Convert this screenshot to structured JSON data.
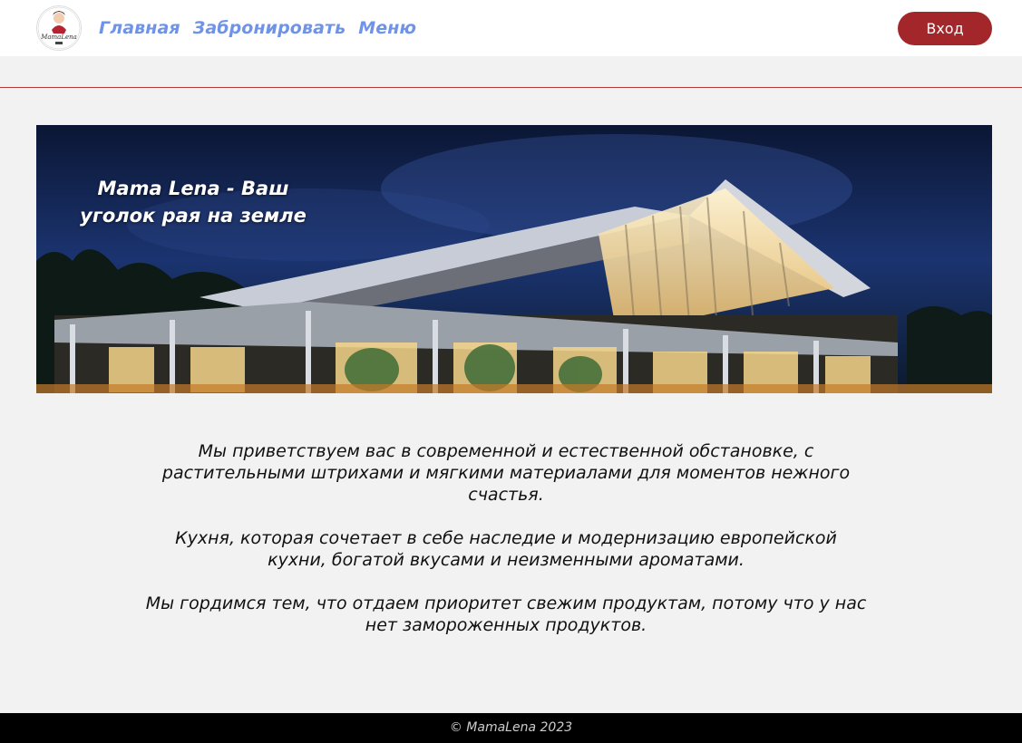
{
  "header": {
    "logo_text": "MamaLena",
    "nav": [
      {
        "label": "Главная"
      },
      {
        "label": "Забронировать"
      },
      {
        "label": "Меню"
      }
    ],
    "login_label": "Вход"
  },
  "hero": {
    "title": "Mama Lena - Ваш уголок рая на земле",
    "image_description_icon": "restaurant-building-image"
  },
  "content": {
    "paragraphs": [
      "Мы приветствуем вас в современной и естественной обстановке, с растительными штрихами и мягкими материалами для моментов нежного счастья.",
      "Кухня, которая сочетает в себе наследие и модернизацию европейской кухни, богатой вкусами и неизменными ароматами.",
      "Мы гордимся тем, что отдаем приоритет свежим продуктам, потому что у нас нет замороженных продуктов."
    ]
  },
  "footer": {
    "copyright": "© MamaLena 2023"
  },
  "colors": {
    "nav_link": "#6f93e8",
    "login_button": "#a3262a",
    "divider": "#b33a3a",
    "footer_bg": "#000000",
    "page_bg": "#f2f2f2"
  }
}
